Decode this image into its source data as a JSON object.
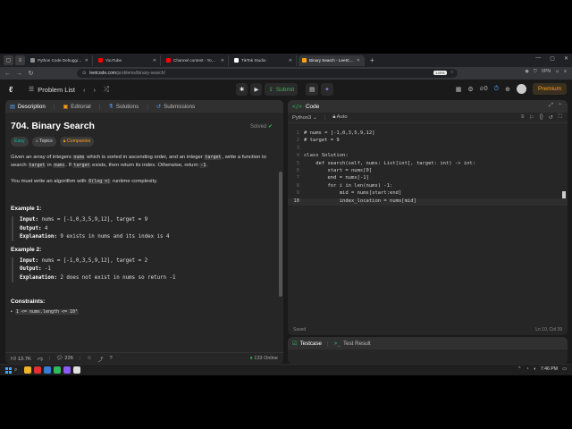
{
  "browser": {
    "tabs": [
      {
        "title": "Python Code Debugging",
        "color": "#8e8e8e"
      },
      {
        "title": "YouTube",
        "color": "#ff0000"
      },
      {
        "title": "Channel content - YouTube St",
        "color": "#ff0000"
      },
      {
        "title": "TikTok Studio",
        "color": "#ffffff"
      },
      {
        "title": "Binary Search - LeetCode",
        "color": "#ffa116"
      }
    ],
    "url_host": "leetcode.com",
    "url_path": "/problems/binary-search/",
    "zoom": "140%",
    "vpn": "VPN"
  },
  "lc_nav": {
    "problem_list": "Problem List",
    "submit": "Submit",
    "premium": "Premium",
    "streak": "0"
  },
  "problem": {
    "tabs": [
      "Description",
      "Editorial",
      "Solutions",
      "Submissions"
    ],
    "title": "704. Binary Search",
    "solved": "Solved",
    "tags": [
      "Easy",
      "Topics",
      "Companies"
    ],
    "desc_1a": "Given an array of integers ",
    "desc_1b": "nums",
    "desc_1c": " which is sorted in ascending order, and an integer ",
    "desc_1d": "target",
    "desc_1e": ", write a function to search ",
    "desc_1f": "target",
    "desc_1g": " in ",
    "desc_1h": "nums",
    "desc_1i": ". If ",
    "desc_1j": "target",
    "desc_1k": " exists, then return its index. Otherwise, return ",
    "desc_1l": "-1",
    "desc_1m": ".",
    "desc_2a": "You must write an algorithm with ",
    "desc_2b": "O(log n)",
    "desc_2c": " runtime complexity.",
    "ex1_title": "Example 1:",
    "ex1_input_label": "Input:",
    "ex1_input": " nums = [-1,0,3,5,9,12], target = 9",
    "ex1_output_label": "Output:",
    "ex1_output": " 4",
    "ex1_expl_label": "Explanation:",
    "ex1_expl": " 9 exists in nums and its index is 4",
    "ex2_title": "Example 2:",
    "ex2_input_label": "Input:",
    "ex2_input": " nums = [-1,0,3,5,9,12], target = 2",
    "ex2_output_label": "Output:",
    "ex2_output": " -1",
    "ex2_expl_label": "Explanation:",
    "ex2_expl": " 2 does not exist in nums so return -1",
    "constraints_title": "Constraints:",
    "constraint_1": "1 <= nums.length <= 10⁴",
    "likes": "13.7K",
    "comments": "226",
    "online": "133 Online"
  },
  "code_panel": {
    "title": "Code",
    "language": "Python3",
    "mode": "Auto",
    "saved": "Saved",
    "cursor": "Ln 10, Col 39",
    "lines": [
      {
        "n": "1",
        "code": "# nums = [-1,0,3,5,9,12]"
      },
      {
        "n": "2",
        "code": "# target = 9"
      },
      {
        "n": "3",
        "code": ""
      },
      {
        "n": "4",
        "code": "class Solution:"
      },
      {
        "n": "5",
        "code": "    def search(self, nums: List[int], target: int) -> int:"
      },
      {
        "n": "6",
        "code": "        start = nums[0]"
      },
      {
        "n": "7",
        "code": "        end = nums[-1]"
      },
      {
        "n": "8",
        "code": "        for i in len(nums) -1:"
      },
      {
        "n": "9",
        "code": "            mid = nums[start:end]"
      },
      {
        "n": "10",
        "code": "            index_location = nums[mid]"
      }
    ]
  },
  "test_panel": {
    "testcase": "Testcase",
    "result": "Test Result"
  },
  "taskbar": {
    "time": "7:46 PM"
  }
}
